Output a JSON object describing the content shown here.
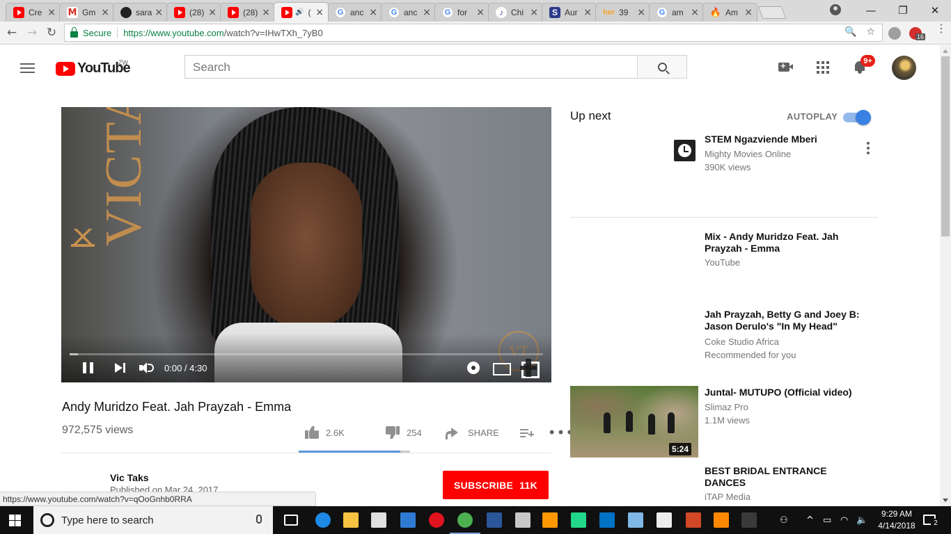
{
  "browser": {
    "tabs": [
      {
        "title": "Cre",
        "favicon": "youtube-icon"
      },
      {
        "title": "Gm",
        "favicon": "gmail-icon"
      },
      {
        "title": "sara",
        "favicon": "github-icon"
      },
      {
        "title": "(28)",
        "favicon": "youtube-icon"
      },
      {
        "title": "(28)",
        "favicon": "youtube-icon"
      },
      {
        "title": "(",
        "favicon": "youtube-icon",
        "active": true,
        "audio": "🔊"
      },
      {
        "title": "anc",
        "favicon": "google-icon"
      },
      {
        "title": "anc",
        "favicon": "google-icon"
      },
      {
        "title": "for",
        "favicon": "google-icon"
      },
      {
        "title": "Chi",
        "favicon": "chrome-extension-icon"
      },
      {
        "title": "Aur",
        "favicon": "s-icon"
      },
      {
        "title": "39",
        "favicon": "her-icon",
        "favicon_text": "her"
      },
      {
        "title": "am",
        "favicon": "google-icon"
      },
      {
        "title": "Am",
        "favicon": "fire-icon"
      }
    ],
    "tab_close": "×",
    "favicon_letters": {
      "gmail": "M",
      "google": "G",
      "chrome": "♪",
      "s": "S",
      "fire": "🔥"
    },
    "window_controls": {
      "minimize": "—",
      "maximize": "❐",
      "close": "✕"
    },
    "nav": {
      "back": "←",
      "forward": "→",
      "reload": "↻"
    },
    "address_bar": {
      "secure_label": "Secure",
      "url_scheme_host": "https://www.youtube.com",
      "url_path": "/watch?v=IHwTXh_7yB0",
      "zoom_icon": "🔍",
      "star_icon": "☆"
    },
    "extension_badge": "16",
    "menu_icon": "⋮",
    "status_url": "https://www.youtube.com/watch?v=qOoGnhb0RRA"
  },
  "youtube": {
    "logo_text": "YouTube",
    "country": "ZW",
    "search_placeholder": "Search",
    "notification_count": "9+"
  },
  "video": {
    "title": "Andy Muridzo Feat. Jah Prayzah - Emma",
    "views": "972,575 views",
    "likes": "2.6K",
    "dislikes": "254",
    "share_label": "SHARE",
    "more_label": "•••",
    "like_ratio": 0.91,
    "watermark_text": "VICTAKS",
    "logo_mark": "VT",
    "player": {
      "current_time": "0:00",
      "duration": "4:30",
      "time_display": "0:00 / 4:30",
      "played_fraction": 0.0,
      "buffered_fraction": 0.018
    }
  },
  "channel": {
    "name": "Vic Taks",
    "published": "Published on Mar 24, 2017",
    "subscribe_label": "SUBSCRIBE",
    "subscriber_count": "11K"
  },
  "sidebar": {
    "up_next_label": "Up next",
    "autoplay_label": "AUTOPLAY",
    "autoplay_on": true,
    "recommendations": [
      {
        "title": "STEM Ngazviende Mberi",
        "channel": "Mighty Movies Online",
        "meta": "390K views"
      },
      {
        "title": "Mix - Andy Muridzo Feat. Jah Prayzah - Emma",
        "channel": "YouTube",
        "meta": ""
      },
      {
        "title": "Jah Prayzah, Betty G and Joey B: Jason Derulo's \"In My Head\"",
        "channel": "Coke Studio Africa",
        "meta": "Recommended for you"
      },
      {
        "title": "Juntal- MUTUPO (Official video)",
        "channel": "Slimaz Pro",
        "meta": "1.1M views",
        "duration": "5:24"
      },
      {
        "title": "BEST BRIDAL ENTRANCE DANCES",
        "channel": "iTAP Media",
        "meta": ""
      }
    ]
  },
  "taskbar": {
    "search_placeholder": "Type here to search",
    "time": "9:29 AM",
    "date": "4/14/2018",
    "notification_count": "2",
    "apps": [
      "task-view-icon",
      "edge-icon",
      "file-explorer-icon",
      "mail-icon",
      "app-blue-icon",
      "opera-icon",
      "chrome-icon",
      "word-icon",
      "paint-icon",
      "sublime-icon",
      "pycharm-icon",
      "outlook-icon",
      "notepad-icon",
      "photos-icon",
      "powerpoint-icon",
      "vlc-icon",
      "terminal-icon"
    ],
    "tray": {
      "people": "⚇",
      "chevron": "^",
      "battery": "▭",
      "wifi": "◠",
      "volume": "🔈"
    }
  },
  "colors": {
    "youtube_red": "#ff0000",
    "link_blue": "#3a81e3",
    "secure_green": "#0b8043",
    "text_gray": "#606060"
  }
}
